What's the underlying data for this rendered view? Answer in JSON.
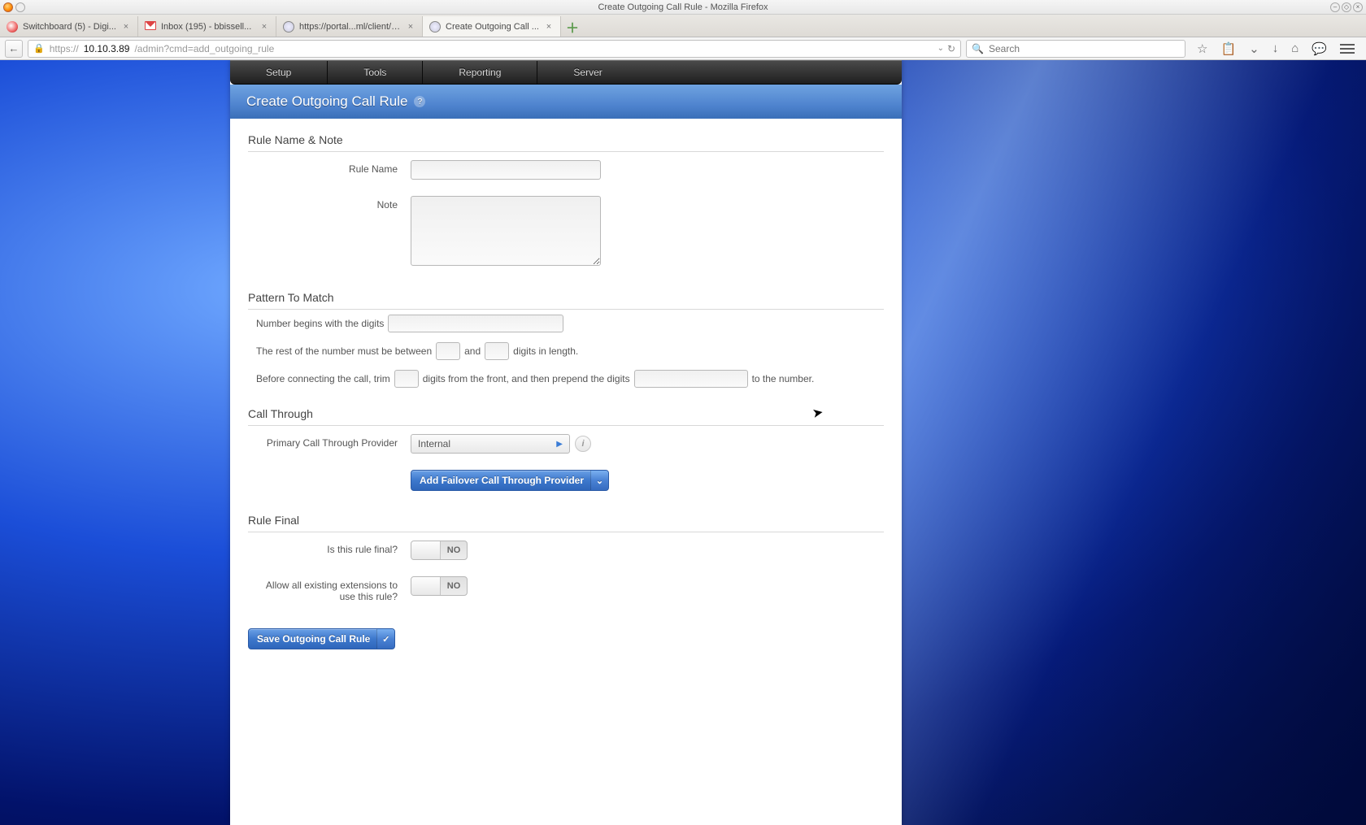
{
  "window": {
    "title": "Create Outgoing Call Rule - Mozilla Firefox"
  },
  "tabs": [
    {
      "label": "Switchboard (5) - Digi..."
    },
    {
      "label": "Inbox (195) - bbissell..."
    },
    {
      "label": "https://portal...ml/client/list"
    },
    {
      "label": "Create Outgoing Call ..."
    }
  ],
  "url": {
    "scheme": "https://",
    "host": "10.10.3.89",
    "path": "/admin?cmd=add_outgoing_rule"
  },
  "search": {
    "placeholder": "Search"
  },
  "nav": {
    "items": [
      "Setup",
      "Tools",
      "Reporting",
      "Server"
    ]
  },
  "page": {
    "title": "Create Outgoing Call Rule"
  },
  "sections": {
    "rule_name_note": {
      "title": "Rule Name & Note",
      "rule_name_label": "Rule Name",
      "rule_name_value": "",
      "note_label": "Note",
      "note_value": ""
    },
    "pattern": {
      "title": "Pattern To Match",
      "line1_pre": "Number begins with the digits",
      "begins_value": "",
      "line2_a": "The rest of the number must be between",
      "min_value": "",
      "line2_b": "and",
      "max_value": "",
      "line2_c": "digits in length.",
      "line3_a": "Before connecting the call, trim",
      "trim_value": "",
      "line3_b": "digits from the front, and then prepend the digits",
      "prepend_value": "",
      "line3_c": "to the number."
    },
    "call_through": {
      "title": "Call Through",
      "primary_label": "Primary Call Through Provider",
      "primary_value": "Internal",
      "add_failover_label": "Add Failover Call Through Provider"
    },
    "rule_final": {
      "title": "Rule Final",
      "final_label": "Is this rule final?",
      "final_state": "NO",
      "allow_label": "Allow all existing extensions to use this rule?",
      "allow_state": "NO"
    }
  },
  "buttons": {
    "save": "Save Outgoing Call Rule"
  }
}
